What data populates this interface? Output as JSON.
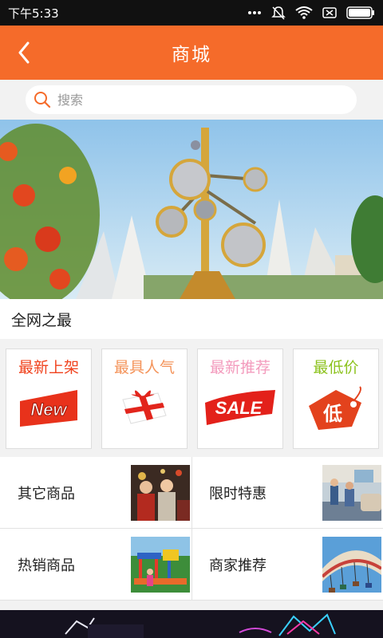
{
  "status_bar": {
    "time": "下午5:33",
    "icons": [
      "more-dots-icon",
      "mute-bell-icon",
      "wifi-icon",
      "sim-card-icon",
      "battery-icon"
    ]
  },
  "header": {
    "title": "商城",
    "back_icon": "chevron-left-icon"
  },
  "search": {
    "placeholder": "搜索",
    "icon": "search-icon"
  },
  "banner": {
    "description_icon": "banner-image"
  },
  "section": {
    "title": "全网之最"
  },
  "cards": [
    {
      "title": "最新上架",
      "color": "#f0431e",
      "icon": "new-badge-icon"
    },
    {
      "title": "最具人气",
      "color": "#f4945b",
      "icon": "gift-box-icon"
    },
    {
      "title": "最新推荐",
      "color": "#f39bbd",
      "icon": "sale-tag-icon"
    },
    {
      "title": "最低价",
      "color": "#8cc21d",
      "icon": "low-price-tag-icon"
    }
  ],
  "grid": [
    {
      "label": "其它商品"
    },
    {
      "label": "限时特惠"
    },
    {
      "label": "热销商品"
    },
    {
      "label": "商家推荐"
    }
  ],
  "colors": {
    "accent": "#f56b2a",
    "background": "#f2f2f2"
  }
}
